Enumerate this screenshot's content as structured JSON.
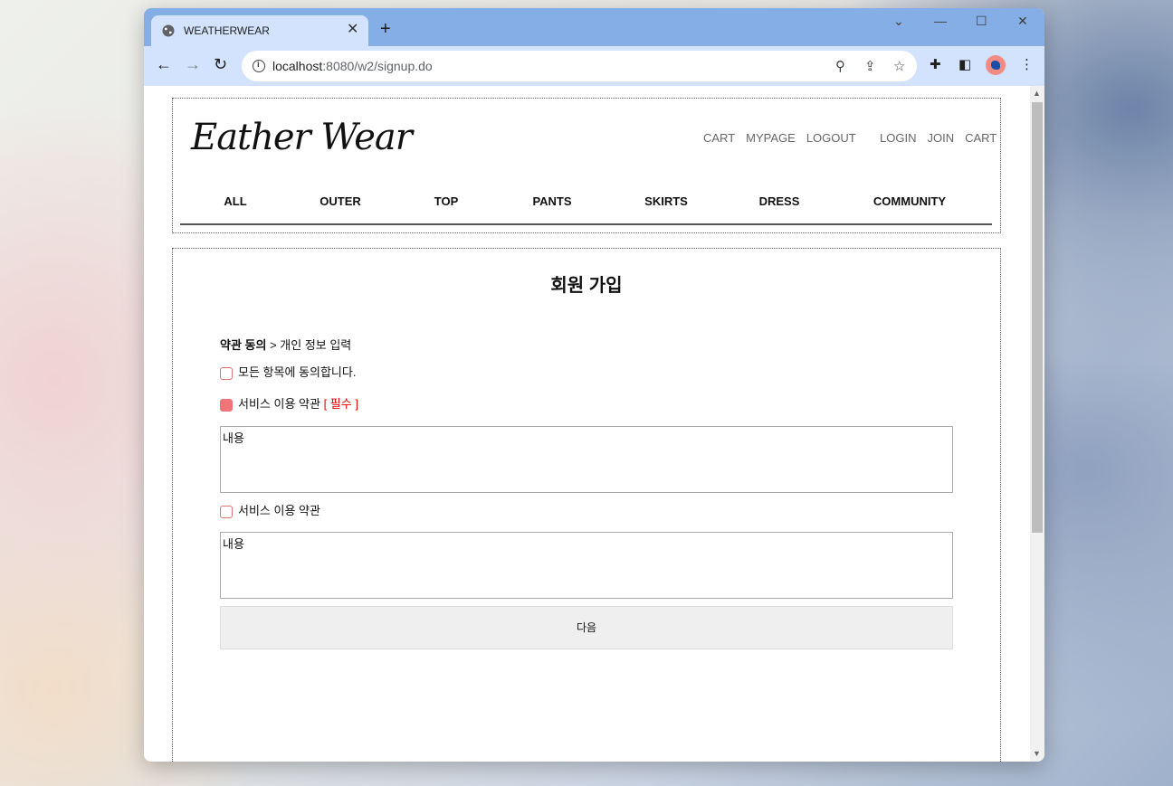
{
  "browser": {
    "tab_title": "WEATHERWEAR",
    "tab_close": "✕",
    "new_tab": "+",
    "url_host": "localhost",
    "url_path": ":8080/w2/signup.do",
    "controls": {
      "dropdown": "⌄",
      "minimize": "—",
      "maximize": "☐",
      "close": "✕"
    }
  },
  "site": {
    "logo": "Eather Wear",
    "top_links_member": [
      "CART",
      "MYPAGE",
      "LOGOUT"
    ],
    "top_links_guest": [
      "LOGIN",
      "JOIN",
      "CART"
    ],
    "nav": [
      "ALL",
      "OUTER",
      "TOP",
      "PANTS",
      "SKIRTS",
      "DRESS",
      "COMMUNITY"
    ]
  },
  "signup": {
    "title": "회원 가입",
    "step_current": "약관 동의",
    "step_sep": " > ",
    "step_next": "개인 정보 입력",
    "agree_all": "모든 항목에 동의합니다.",
    "term1_label": "서비스 이용 약관",
    "term1_required": "[ 필수 ]",
    "term1_checked": true,
    "term1_content": "내용",
    "term2_label": "서비스 이용 약관",
    "term2_checked": false,
    "term2_content": "내용",
    "next_button": "다음"
  },
  "colors": {
    "titlebar": "#86aee6",
    "toolbar": "#d3e3fd",
    "checkbox_accent": "#f0757a",
    "required_text": "#e00000"
  }
}
